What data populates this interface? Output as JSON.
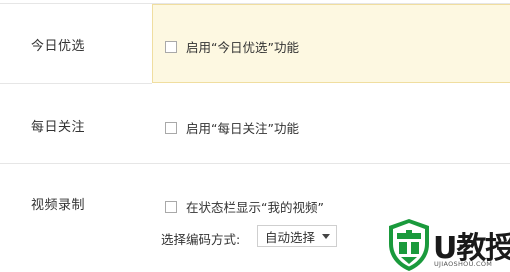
{
  "settings": {
    "rows": [
      {
        "label": "今日优选",
        "option": "启用“今日优选”功能",
        "checked": false
      },
      {
        "label": "每日关注",
        "option": "启用“每日关注”功能",
        "checked": false
      },
      {
        "label": "视频录制",
        "option": "在状态栏显示“我的视频”",
        "checked": false
      }
    ],
    "codec": {
      "label": "选择编码方式:",
      "selected": "自动选择"
    }
  },
  "watermark": {
    "brand": "U教授",
    "site": "UJIAOSHOU.COM",
    "accent": "#1a9a3c"
  }
}
